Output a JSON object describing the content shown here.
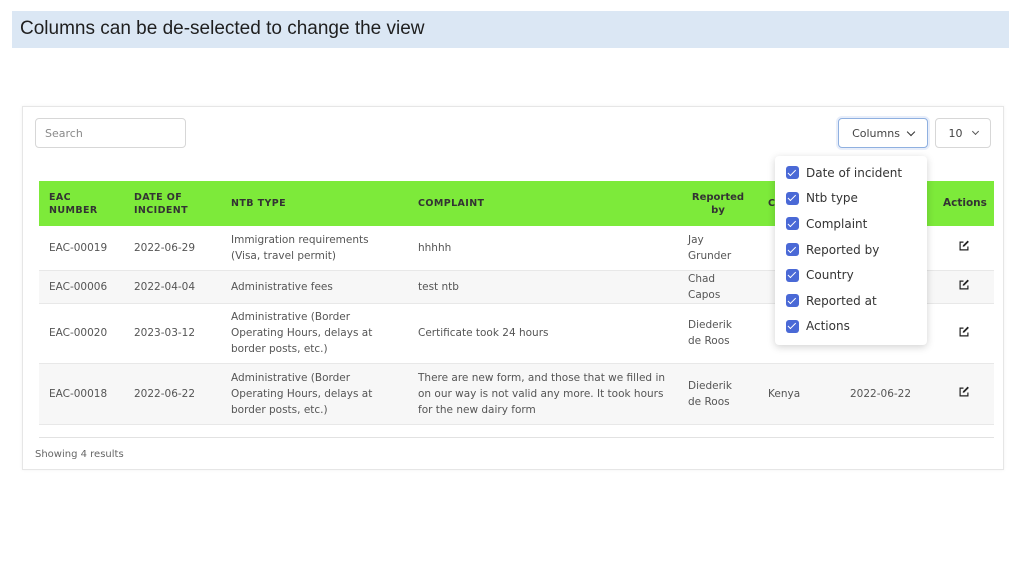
{
  "slide": {
    "title": "Columns can be de-selected to change the view",
    "banner_color": "#dbe7f4"
  },
  "toolbar": {
    "search_placeholder": "Search",
    "columns_label": "Columns",
    "per_page_value": "10"
  },
  "table": {
    "header_color": "#7dea3a",
    "headers": {
      "eac_number": [
        "EAC",
        "NUMBER"
      ],
      "date_of_incident": [
        "DATE OF",
        "INCIDENT"
      ],
      "ntb_type": "NTB TYPE",
      "complaint": "COMPLAINT",
      "reported_by": [
        "Reported",
        "by"
      ],
      "country": "C",
      "actions": "Actions"
    },
    "rows": [
      {
        "eac": "EAC-00019",
        "date": "2022-06-29",
        "ntb": "Immigration requirements (Visa, travel permit)",
        "complaint": "hhhhh",
        "reported_by": "Jay Grunder",
        "country": "",
        "reported_at": ""
      },
      {
        "eac": "EAC-00006",
        "date": "2022-04-04",
        "ntb": "Administrative fees",
        "complaint": "test ntb",
        "reported_by": "Chad Capos",
        "country": "",
        "reported_at": ""
      },
      {
        "eac": "EAC-00020",
        "date": "2023-03-12",
        "ntb": "Administrative (Border Operating Hours, delays at border posts, etc.)",
        "complaint": "Certificate took 24 hours",
        "reported_by": "Diederik de Roos",
        "country": "",
        "reported_at": ""
      },
      {
        "eac": "EAC-00018",
        "date": "2022-06-22",
        "ntb": "Administrative (Border Operating Hours, delays at border posts, etc.)",
        "complaint": "There are new form, and those that we filled in on our way is not valid any more. It took hours for the new dairy form",
        "reported_by": "Diederik de Roos",
        "country": "Kenya",
        "reported_at": "2022-06-22"
      }
    ],
    "edit_icon": "edit-icon"
  },
  "footer": {
    "results_text": "Showing 4 results"
  },
  "columns_menu": {
    "accent_color": "#4a69d6",
    "items": [
      {
        "label": "Date of incident",
        "checked": true
      },
      {
        "label": "Ntb type",
        "checked": true
      },
      {
        "label": "Complaint",
        "checked": true
      },
      {
        "label": "Reported by",
        "checked": true
      },
      {
        "label": "Country",
        "checked": true
      },
      {
        "label": "Reported at",
        "checked": true
      },
      {
        "label": "Actions",
        "checked": true
      }
    ]
  }
}
